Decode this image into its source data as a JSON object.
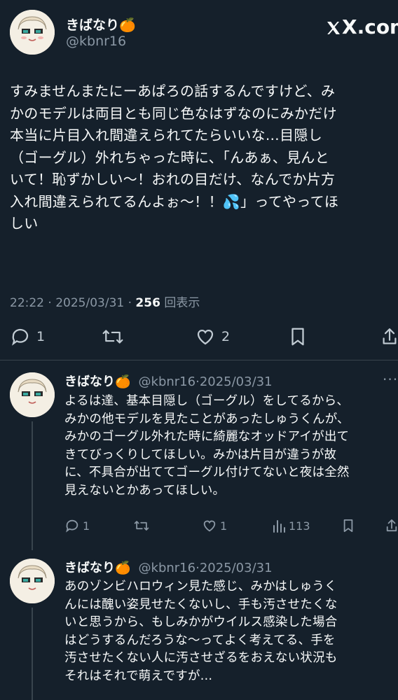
{
  "brand": "X.com",
  "main_tweet": {
    "author_name": "きばなり🍊",
    "author_handle": "@kbnr16",
    "text": "すみませんまたにーあぱろの話するんですけど、み\nかのモデルは両目とも同じ色なはずなのにみかだけ\n本当に片目入れ間違えられてたらいいな…目隠し\n（ゴーグル）外れちゃった時に、「んあぁ、見んと\nいて！恥ずかしい〜！おれの目だけ、なんでか片方\n入れ間違えられてるんよぉ〜！！💦」ってやってほ\nしい",
    "time": "22:22",
    "date": "2025/03/31",
    "views_count": "256",
    "views_label": "回表示",
    "replies": "1",
    "likes": "2"
  },
  "replies": [
    {
      "author_name": "きばなり🍊",
      "author_handle": "@kbnr16",
      "date": "2025/03/31",
      "text": "よるは達、基本目隠し（ゴーグル）をしてるから、\nみかの他モデルを見たことがあったしゅうくんが、\nみかのゴーグル外れた時に綺麗なオッドアイが出て\nきてびっくりしてほしい。みかは片目が違うが故\nに、不具合が出ててゴーグル付けてないと夜は全然\n見えないとかあってほしい。",
      "replies": "1",
      "likes": "1",
      "views": "113"
    },
    {
      "author_name": "きばなり🍊",
      "author_handle": "@kbnr16",
      "date": "2025/03/31",
      "text": "あのゾンビハロウィン見た感じ、みかはしゅうく\nんには醜い姿見せたくないし、手も汚させたくな\nいと思うから、もしみかがウイルス感染した場合\nはどうするんだろうな〜ってよく考えてる、手を\n汚させたくない人に汚させざるをおえない状況も\nそれはそれで萌えですが…"
    }
  ],
  "separator": "·",
  "more_dots": "···",
  "colors": {
    "background": "#15202b",
    "text": "#f7f9f9",
    "muted": "#8b98a5",
    "border": "#38444d"
  },
  "icons": [
    "reply-icon",
    "retweet-icon",
    "like-icon",
    "bookmark-icon",
    "share-icon",
    "views-icon",
    "more-icon",
    "x-logo-icon"
  ]
}
